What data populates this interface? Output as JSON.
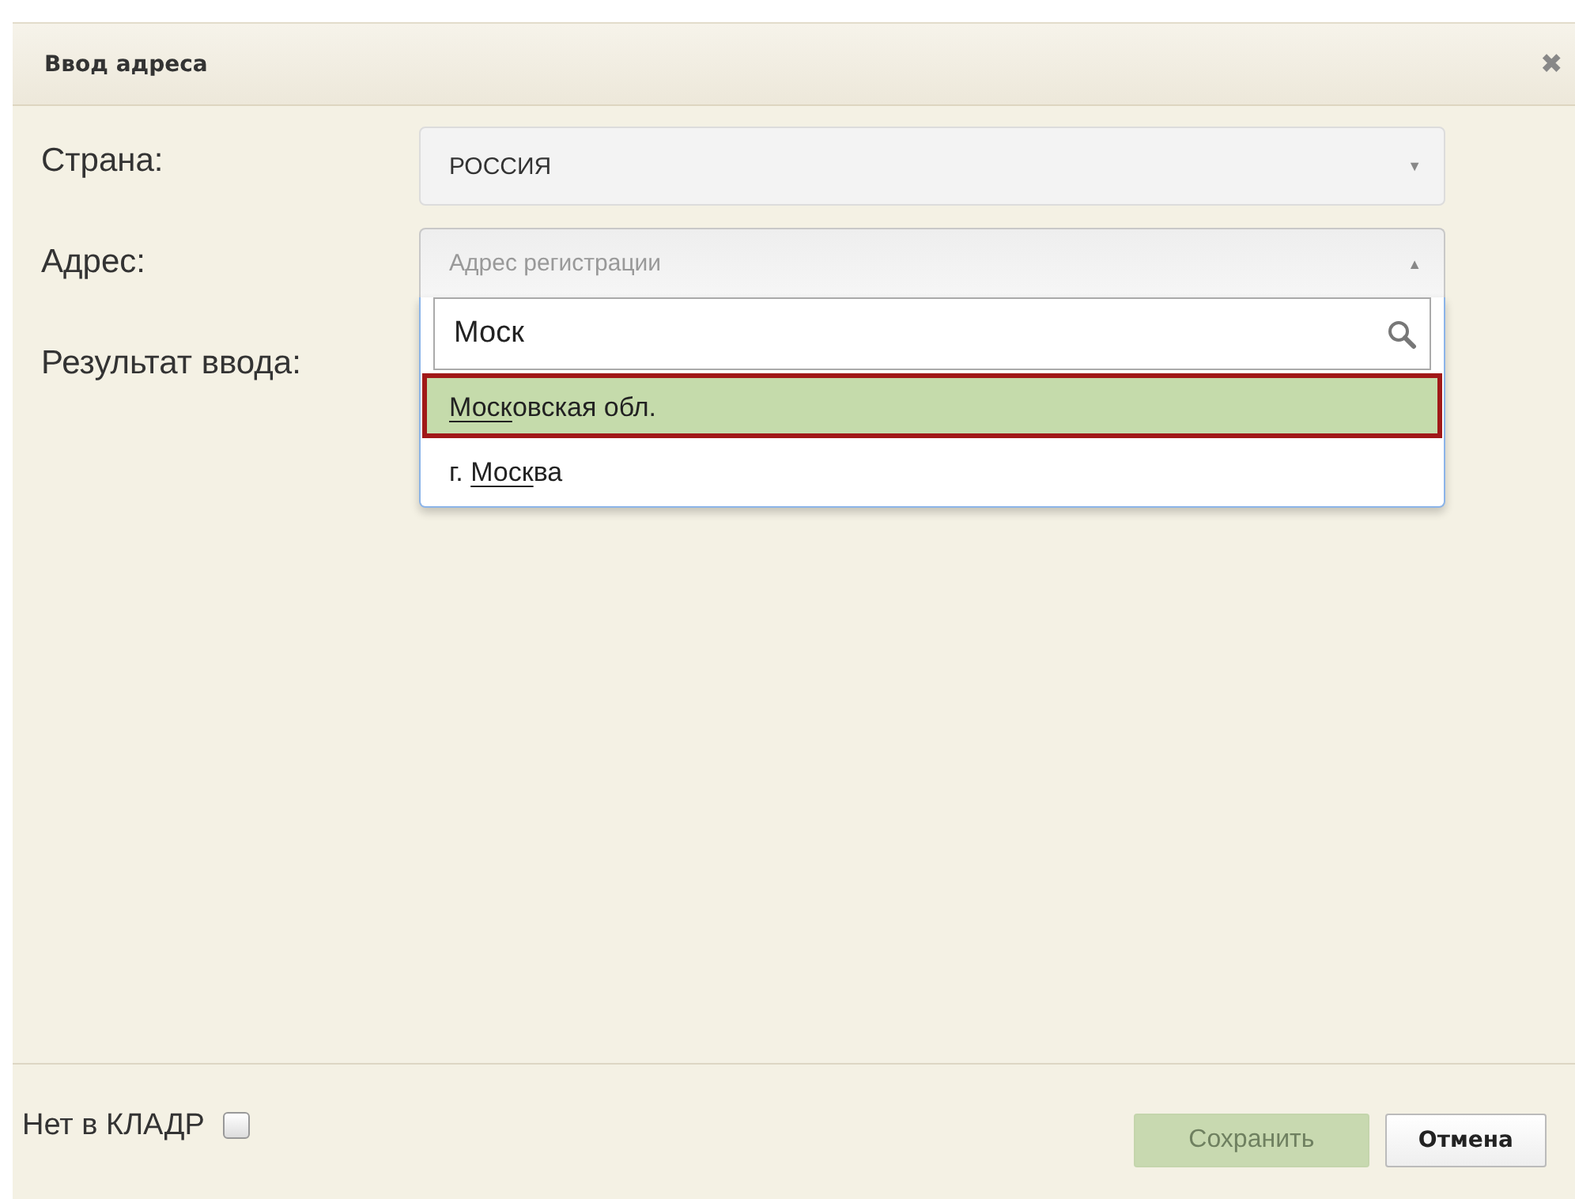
{
  "window": {
    "title": "Ввод адреса",
    "close": "✖"
  },
  "fields": [
    {
      "label": "Страна:",
      "kind": "select",
      "value": "РОССИЯ",
      "expanded": false,
      "arrow": "▼"
    },
    {
      "label": "Адрес:",
      "kind": "combo",
      "placeholder": "Адрес регистрации",
      "expanded": true,
      "arrow": "▲",
      "search": "Моск",
      "options": [
        {
          "match": "Моск",
          "after": "овская обл.",
          "selected": true
        },
        {
          "before": "г. ",
          "match": "Моск",
          "after": "ва",
          "selected": false
        }
      ]
    },
    {
      "label": "Результат ввода:",
      "kind": "label"
    }
  ],
  "footer": {
    "checkbox": {
      "label": "Нет в КЛАДР",
      "checked": false
    },
    "buttons": [
      {
        "label": "Сохранить",
        "disabled": true
      },
      {
        "label": "Отмена",
        "disabled": false
      }
    ]
  }
}
